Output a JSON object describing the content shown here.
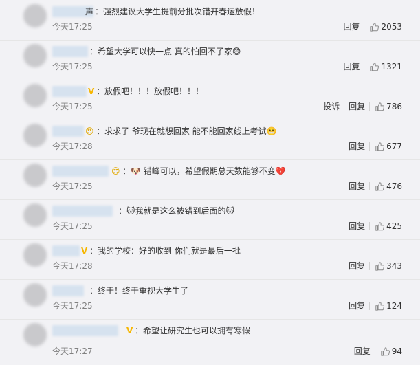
{
  "comments": [
    {
      "name_suffix": "声",
      "badge": "",
      "content": "强烈建议大学生提前分批次错开春运放假！",
      "emoji": "",
      "time": "今天17:25",
      "report": "",
      "reply": "回复",
      "likes": "2053"
    },
    {
      "name_suffix": "",
      "badge": "",
      "content": "希望大学可以快一点 真的怕回不了家",
      "emoji": "😅",
      "time": "今天17:25",
      "report": "",
      "reply": "回复",
      "likes": "1321"
    },
    {
      "name_suffix": "",
      "badge": "V",
      "content": "放假吧！！！放假吧！！！",
      "emoji": "",
      "time": "今天17:25",
      "report": "投诉",
      "reply": "回复",
      "likes": "786"
    },
    {
      "name_suffix": "",
      "badge": "😍",
      "content": "求求了 爷现在就想回家 能不能回家线上考试",
      "emoji": "😬",
      "time": "今天17:28",
      "report": "",
      "reply": "回复",
      "likes": "677"
    },
    {
      "name_suffix": "",
      "badge": "😍",
      "content": "错峰可以，希望假期总天数能够不变",
      "emoji": "💔",
      "time": "今天17:25",
      "report": "",
      "reply": "回复",
      "likes": "476",
      "prefix_emoji": "🐶"
    },
    {
      "name_suffix": "",
      "badge": "",
      "content": "我就是这么被错到后面的",
      "emoji": "🐱",
      "time": "今天17:25",
      "report": "",
      "reply": "回复",
      "likes": "425",
      "prefix_emoji": "🐱"
    },
    {
      "name_suffix": "",
      "badge": "V",
      "content": "我的学校：好的收到 你们就是最后一批",
      "emoji": "",
      "time": "今天17:28",
      "report": "",
      "reply": "回复",
      "likes": "343"
    },
    {
      "name_suffix": "",
      "badge": "",
      "content": "终于！终于重视大学生了",
      "emoji": "",
      "time": "今天17:25",
      "report": "",
      "reply": "回复",
      "likes": "124"
    },
    {
      "name_suffix": "_",
      "badge": "V",
      "content": "希望让研究生也可以拥有寒假",
      "emoji": "",
      "time": "今天17:27",
      "report": "",
      "reply": "回复",
      "likes": "94"
    }
  ]
}
